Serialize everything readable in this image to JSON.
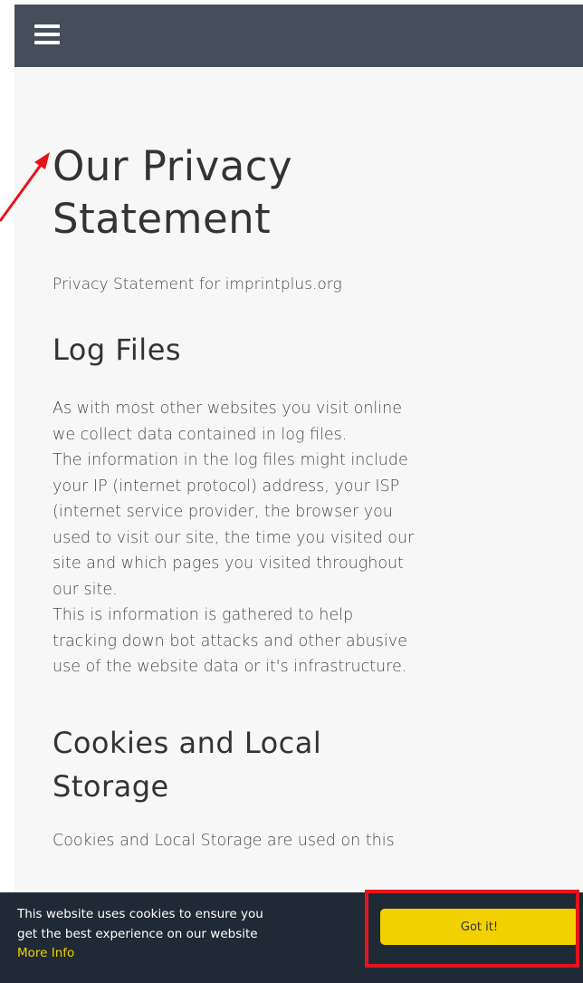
{
  "header": {
    "menu_icon": "hamburger-menu-icon"
  },
  "main": {
    "title_lines": [
      "Our Privacy",
      "Statement"
    ],
    "subtitle": "Privacy Statement for imprintplus.org",
    "sections": [
      {
        "heading_lines": [
          "Log Files"
        ],
        "paragraph_lines": [
          "As with most other websites you visit online",
          "we collect data contained in log files.",
          "The information in the log files might include",
          "your IP (internet protocol) address, your ISP",
          "(internet service provider, the browser you",
          "used to visit our site, the time you visited our",
          "site and which pages you visited throughout",
          "our site.",
          "This is information is gathered to help",
          "tracking down bot attacks and other abusive",
          "use of the website data or it's infrastructure."
        ]
      },
      {
        "heading_lines": [
          "Cookies and Local",
          "Storage"
        ],
        "paragraph_lines": [
          "Cookies and Local Storage are used on this"
        ]
      }
    ]
  },
  "cookie_banner": {
    "message_lines": [
      "This website uses cookies to ensure you",
      "get the best experience on our website"
    ],
    "more_info_label": "More Info",
    "button_label": "Got it!"
  },
  "colors": {
    "header_bg": "#454f5b",
    "page_bg": "#f7f7f7",
    "banner_bg": "#1f2a36",
    "accent_yellow": "#f2d100",
    "annotation_red": "#e5141a"
  }
}
